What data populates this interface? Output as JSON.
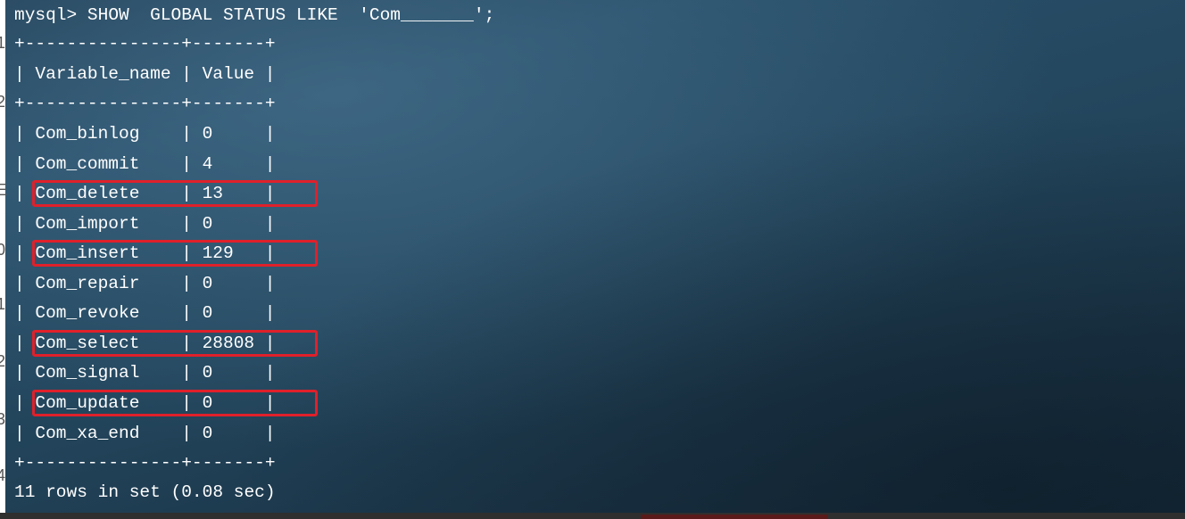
{
  "terminal": {
    "command": "mysql> SHOW  GLOBAL STATUS LIKE  'Com_______';",
    "border_line": "+---------------+-------+",
    "header": {
      "name": "Variable_name",
      "value": "Value"
    },
    "rows": [
      {
        "name": "Com_binlog",
        "value": "0",
        "highlighted": false
      },
      {
        "name": "Com_commit",
        "value": "4",
        "highlighted": false
      },
      {
        "name": "Com_delete",
        "value": "13",
        "highlighted": true
      },
      {
        "name": "Com_import",
        "value": "0",
        "highlighted": false
      },
      {
        "name": "Com_insert",
        "value": "129",
        "highlighted": true
      },
      {
        "name": "Com_repair",
        "value": "0",
        "highlighted": false
      },
      {
        "name": "Com_revoke",
        "value": "0",
        "highlighted": false
      },
      {
        "name": "Com_select",
        "value": "28808",
        "highlighted": true
      },
      {
        "name": "Com_signal",
        "value": "0",
        "highlighted": false
      },
      {
        "name": "Com_update",
        "value": "0",
        "highlighted": true
      },
      {
        "name": "Com_xa_end",
        "value": "0",
        "highlighted": false
      }
    ],
    "footer": "11 rows in set (0.08 sec)"
  },
  "gutter_numbers": [
    "1",
    "2",
    "E",
    "0",
    "1",
    "2",
    "3",
    "4"
  ],
  "colors": {
    "text": "#ffffff",
    "highlight": "#e0202a",
    "background_top": "#284e68",
    "background_bottom": "#162b3b"
  }
}
